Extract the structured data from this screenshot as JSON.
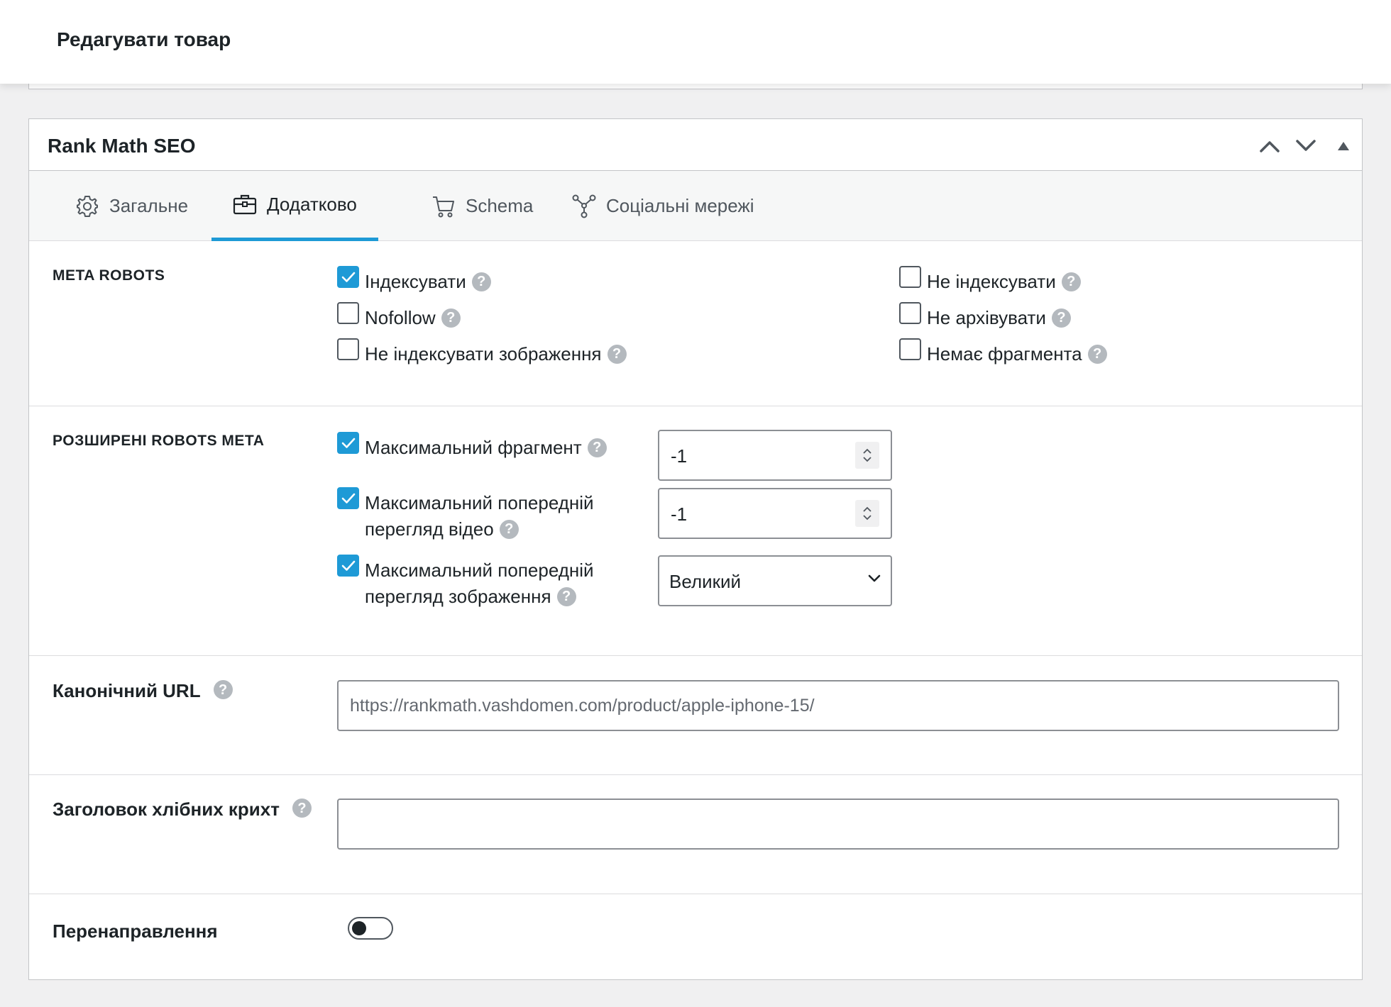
{
  "page": {
    "title": "Редагувати товар"
  },
  "panel": {
    "title": "Rank Math SEO",
    "tabs": [
      {
        "label": "Загальне",
        "icon": "gear-icon"
      },
      {
        "label": "Додатково",
        "icon": "briefcase-icon",
        "active": true
      },
      {
        "label": "Schema",
        "icon": "cart-icon"
      },
      {
        "label": "Соціальні мережі",
        "icon": "share-nodes-icon"
      }
    ]
  },
  "meta_robots": {
    "label": "META ROBOTS",
    "options": [
      {
        "label": "Індексувати",
        "checked": true
      },
      {
        "label": "Nofollow",
        "checked": false
      },
      {
        "label": "Не індексувати зображення",
        "checked": false
      },
      {
        "label": "Не індексувати",
        "checked": false
      },
      {
        "label": "Не архівувати",
        "checked": false
      },
      {
        "label": "Немає фрагмента",
        "checked": false
      }
    ]
  },
  "advanced_robots": {
    "label": "РОЗШИРЕНІ ROBOTS META",
    "max_snippet": {
      "label": "Максимальний фрагмент",
      "checked": true,
      "value": "-1"
    },
    "max_video_preview": {
      "label_line1": "Максимальний попередній",
      "label_line2": "перегляд відео",
      "checked": true,
      "value": "-1"
    },
    "max_image_preview": {
      "label_line1": "Максимальний попередній",
      "label_line2": "перегляд зображення",
      "checked": true,
      "value": "Великий"
    }
  },
  "canonical": {
    "label": "Канонічний URL",
    "placeholder": "https://rankmath.vashdomen.com/product/apple-iphone-15/",
    "value": ""
  },
  "breadcrumb": {
    "label": "Заголовок хлібних крихт",
    "value": ""
  },
  "redirect": {
    "label": "Перенаправлення",
    "enabled": false
  },
  "help_glyph": "?"
}
